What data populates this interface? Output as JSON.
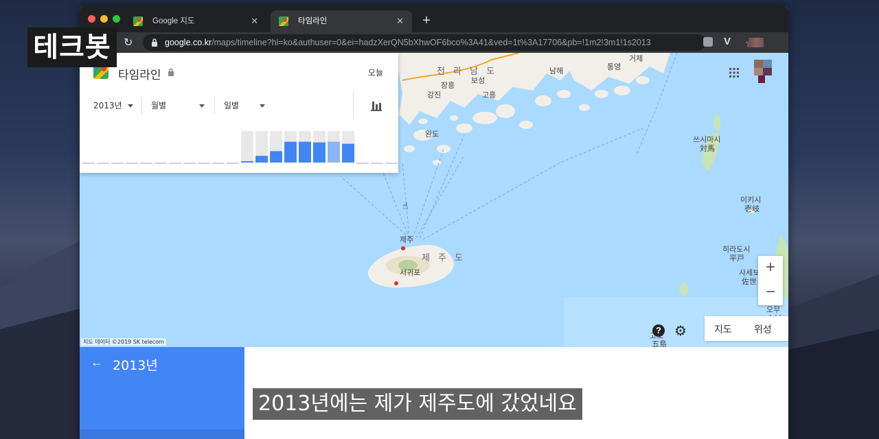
{
  "overlay": {
    "channel_logo": "테크봇",
    "subtitle": "2013년에는 제가 제주도에 갔었네요"
  },
  "browser": {
    "tabs": [
      {
        "label": "Google 지도",
        "active": false
      },
      {
        "label": "타임라인",
        "active": true
      }
    ],
    "url_host": "google.co.kr",
    "url_path": "/maps/timeline?hl=ko&authuser=0&ei=hadzXerQN5bXhwOF6bco%3A41&ved=1t%3A17706&pb=!1m2!3m1!1s2013"
  },
  "timeline": {
    "title": "타임라인",
    "today_label": "오늘",
    "year_select": "2013년",
    "month_select": "월별",
    "day_select": "일별",
    "monthly_activity": [
      0,
      0,
      0,
      0,
      0,
      0,
      0,
      0,
      0,
      0,
      0,
      1,
      10,
      17,
      31,
      31,
      30,
      31,
      28,
      0,
      0,
      0
    ]
  },
  "map": {
    "labels": {
      "jeonnam": "전 라 남 도",
      "namhae": "남해",
      "tongyeong": "통영",
      "geoje": "거제",
      "jangheung": "장흥",
      "boseong": "보성",
      "gangjin": "강진",
      "goheung": "고흥",
      "wando": "완도",
      "jeju_city": "제주",
      "jeju_do": "제 주 도",
      "seogwipo": "서귀포",
      "tsushima": "쓰시마시",
      "tsushima_kanji": "対馬",
      "iki": "이키시",
      "iki_kanji": "壱岐",
      "hirado": "히라도시",
      "hirado_kanji": "平戸",
      "sasebo": "사세보",
      "sasebo_kanji": "佐世",
      "goto": "고토",
      "goto_kanji": "五島",
      "omura": "오무",
      "omura_kanji": "大村"
    },
    "copyright": "지도 데이터 ©2019 SK telecom",
    "map_button": "지도",
    "satellite_button": "위성",
    "zoom_in": "+",
    "zoom_out": "−"
  },
  "sidepanel": {
    "back_label": "←",
    "year_heading": "2013년"
  },
  "colors": {
    "sea": "#aadaff",
    "land": "#f2efe9",
    "accent_blue": "#4285f4",
    "chart_bar": "#4285f4",
    "chart_bar_light": "#8ab4f8"
  }
}
